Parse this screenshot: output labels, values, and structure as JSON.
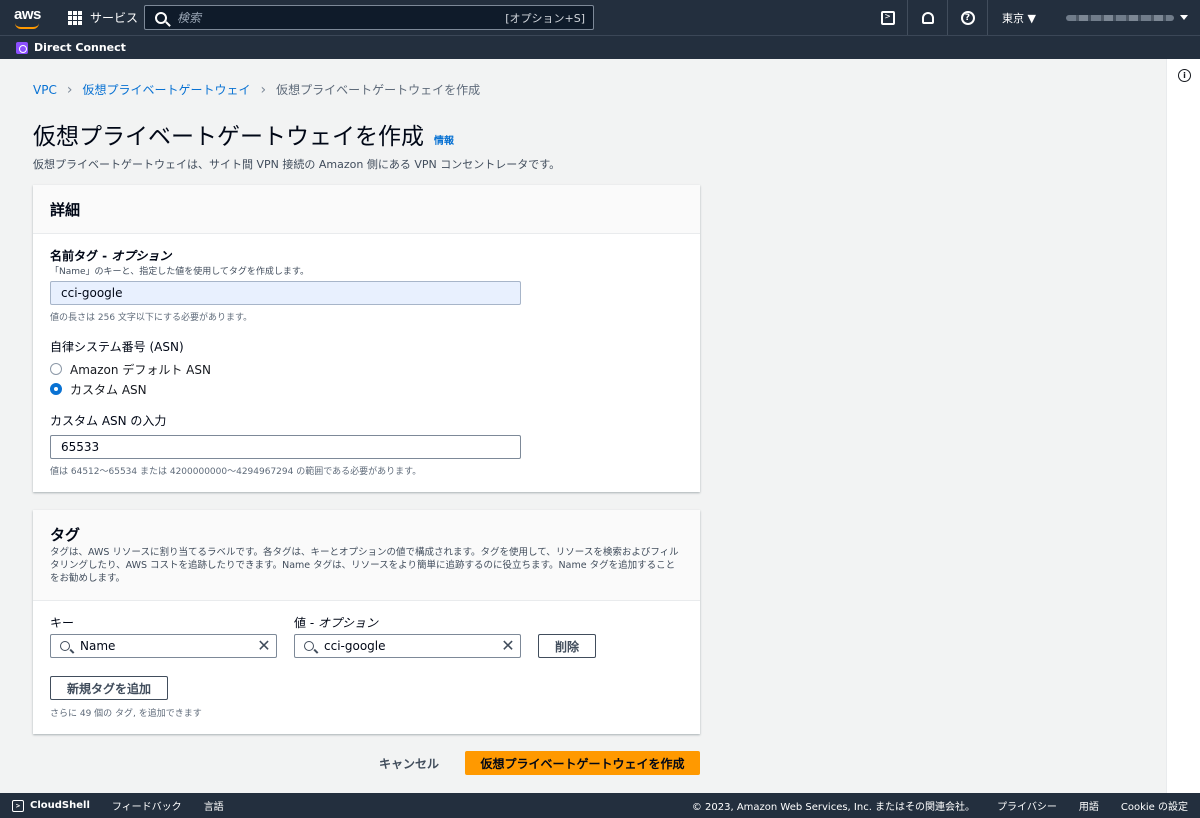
{
  "nav": {
    "logo_text": "aws",
    "services_label": "サービス",
    "search_placeholder": "検索",
    "search_shortcut": "[オプション+S]",
    "region": "東京 ▼"
  },
  "service_bar": {
    "service_name": "Direct Connect"
  },
  "breadcrumb": {
    "items": [
      "VPC",
      "仮想プライベートゲートウェイ"
    ],
    "current": "仮想プライベートゲートウェイを作成"
  },
  "page": {
    "title": "仮想プライベートゲートウェイを作成",
    "info_link": "情報",
    "description": "仮想プライベートゲートウェイは、サイト間 VPN 接続の Amazon 側にある VPN コンセントレータです。"
  },
  "details": {
    "heading": "詳細",
    "name_label": "名前タグ - ",
    "name_label_optional": "オプション",
    "name_sublabel": "「Name」のキーと、指定した値を使用してタグを作成します。",
    "name_value": "cci-google",
    "name_hint": "値の長さは 256 文字以下にする必要があります。",
    "asn_label": "自律システム番号 (ASN)",
    "asn_options": [
      {
        "label": "Amazon デフォルト ASN",
        "selected": false
      },
      {
        "label": "カスタム ASN",
        "selected": true
      }
    ],
    "custom_asn_label": "カスタム ASN の入力",
    "custom_asn_value": "65533",
    "custom_asn_hint": "値は 64512〜65534 または 4200000000〜4294967294 の範囲である必要があります。"
  },
  "tags": {
    "heading": "タグ",
    "description_line1": "タグは、AWS リソースに割り当てるラベルです。各タグは、キーとオプションの値で構成されます。タグを使用して、リソースを検索およびフィルタリングしたり、AWS コストを追跡したりできます。Name タグは、リソースをより簡単に追跡するのに役立ちます。Name タグを追加することをお勧めします。",
    "key_label": "キー",
    "value_label": "値 - ",
    "value_label_optional": "オプション",
    "rows": [
      {
        "key": "Name",
        "value": "cci-google"
      }
    ],
    "remove_label": "削除",
    "add_label": "新規タグを追加",
    "remaining_hint": "さらに 49 個の タグ, を追加できます"
  },
  "actions": {
    "cancel": "キャンセル",
    "submit": "仮想プライベートゲートウェイを作成"
  },
  "footer": {
    "cloudshell": "CloudShell",
    "feedback": "フィードバック",
    "language": "言語",
    "copyright": "© 2023, Amazon Web Services, Inc. またはその関連会社。",
    "privacy": "プライバシー",
    "terms": "用語",
    "cookie": "Cookie の設定"
  },
  "colors": {
    "nav_bg": "#232f3e",
    "primary": "#ff9900",
    "link": "#0972d3"
  }
}
